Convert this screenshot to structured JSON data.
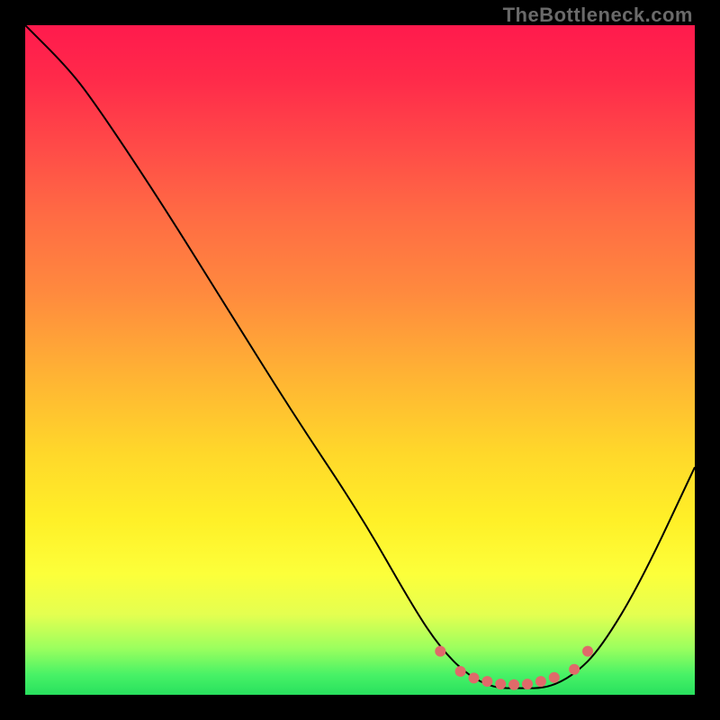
{
  "watermark": "TheBottleneck.com",
  "chart_data": {
    "type": "line",
    "title": "",
    "xlabel": "",
    "ylabel": "",
    "xlim": [
      0,
      100
    ],
    "ylim": [
      0,
      100
    ],
    "series": [
      {
        "name": "bottleneck-curve",
        "x": [
          0,
          6,
          10,
          20,
          30,
          40,
          50,
          58,
          62,
          66,
          70,
          74,
          78,
          82,
          86,
          92,
          100
        ],
        "values": [
          100,
          94,
          89,
          74,
          58,
          42,
          27,
          13,
          7,
          3,
          1,
          1,
          1,
          3,
          7,
          17,
          34
        ]
      }
    ],
    "markers": {
      "name": "optimal-range-dots",
      "x": [
        62,
        65,
        67,
        69,
        71,
        73,
        75,
        77,
        79,
        82,
        84
      ],
      "values": [
        6.5,
        3.5,
        2.5,
        2,
        1.6,
        1.5,
        1.6,
        2,
        2.6,
        3.8,
        6.5
      ],
      "color": "#e06a6a",
      "radius": 6
    },
    "background": {
      "type": "vertical-gradient",
      "stops": [
        {
          "pos": 0.0,
          "color": "#ff1a4d"
        },
        {
          "pos": 0.4,
          "color": "#ff8a3e"
        },
        {
          "pos": 0.74,
          "color": "#fff028"
        },
        {
          "pos": 1.0,
          "color": "#28e05e"
        }
      ]
    }
  }
}
